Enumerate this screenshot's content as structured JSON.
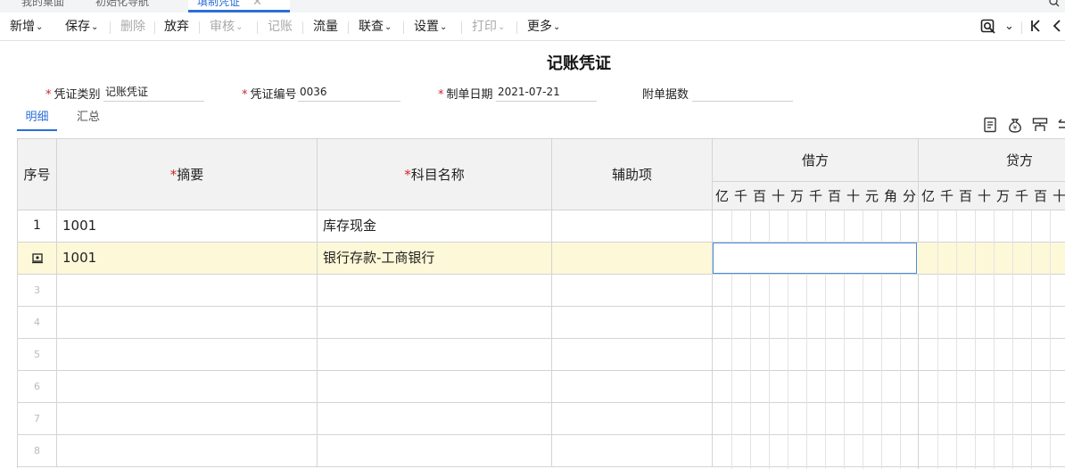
{
  "tabs": [
    {
      "label": "我的桌面",
      "active": false
    },
    {
      "label": "初始化导航",
      "active": false
    },
    {
      "label": "填制凭证",
      "active": true
    }
  ],
  "toolbar": {
    "new": "新增",
    "save": "保存",
    "delete": "删除",
    "discard": "放弃",
    "review": "审核",
    "post": "记账",
    "flow": "流量",
    "lookup": "联查",
    "settings": "设置",
    "print": "打印",
    "more": "更多"
  },
  "title": "记账凭证",
  "fields": {
    "voucher_type_label": "凭证类别",
    "voucher_type_value": "记账凭证",
    "voucher_no_label": "凭证编号",
    "voucher_no_value": "0036",
    "date_label": "制单日期",
    "date_value": "2021-07-21",
    "attachments_label": "附单据数",
    "attachments_value": ""
  },
  "subtabs": [
    "明细",
    "汇总"
  ],
  "table": {
    "headers": {
      "seq": "序号",
      "summary": "摘要",
      "account": "科目名称",
      "aux": "辅助项",
      "debit": "借方",
      "credit": "贷方"
    },
    "debit_digits": [
      "亿",
      "千",
      "百",
      "十",
      "万",
      "千",
      "百",
      "十",
      "元",
      "角",
      "分"
    ],
    "credit_digits": [
      "亿",
      "千",
      "百",
      "十",
      "万",
      "千",
      "百",
      "十"
    ],
    "rows": [
      {
        "seq": "1",
        "summary": "1001",
        "account": "库存现金",
        "aux": ""
      },
      {
        "seq": "",
        "summary": "1001",
        "account": "银行存款-工商银行",
        "aux": ""
      },
      {
        "seq": "3",
        "summary": "",
        "account": "",
        "aux": ""
      },
      {
        "seq": "4",
        "summary": "",
        "account": "",
        "aux": ""
      },
      {
        "seq": "5",
        "summary": "",
        "account": "",
        "aux": ""
      },
      {
        "seq": "6",
        "summary": "",
        "account": "",
        "aux": ""
      },
      {
        "seq": "7",
        "summary": "",
        "account": "",
        "aux": ""
      },
      {
        "seq": "8",
        "summary": "",
        "account": "",
        "aux": ""
      }
    ]
  },
  "colors": {
    "accent": "#2a6fd6",
    "required": "#d02424",
    "active_row": "#fdf8d8",
    "header_bg": "#f2f2f2"
  }
}
